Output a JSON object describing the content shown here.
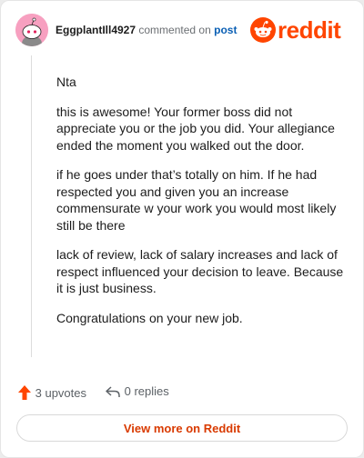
{
  "header": {
    "username": "EggplantIll4927",
    "action_text": "commented on",
    "post_link": "post",
    "logo_text": "reddit"
  },
  "comment": {
    "paragraphs": [
      "Nta",
      "this is awesome! Your former boss did not appreciate you or the job you did. Your allegiance ended the moment you walked out the door.",
      "if he goes under that’s totally on him. If he had respected you and given you an increase commensurate w your work you would most likely still be there",
      "lack of review, lack of salary increases and lack of respect influenced your decision to leave. Because it is just business.",
      "Congratulations on your new job."
    ]
  },
  "actions": {
    "upvotes": "3 upvotes",
    "replies": "0 replies"
  },
  "footer": {
    "view_more": "View more on Reddit"
  },
  "colors": {
    "brand": "#ff4500",
    "upvote_arrow": "#ff4500",
    "link": "#0a5fb4",
    "avatar_bg": "#f7a0c0"
  }
}
